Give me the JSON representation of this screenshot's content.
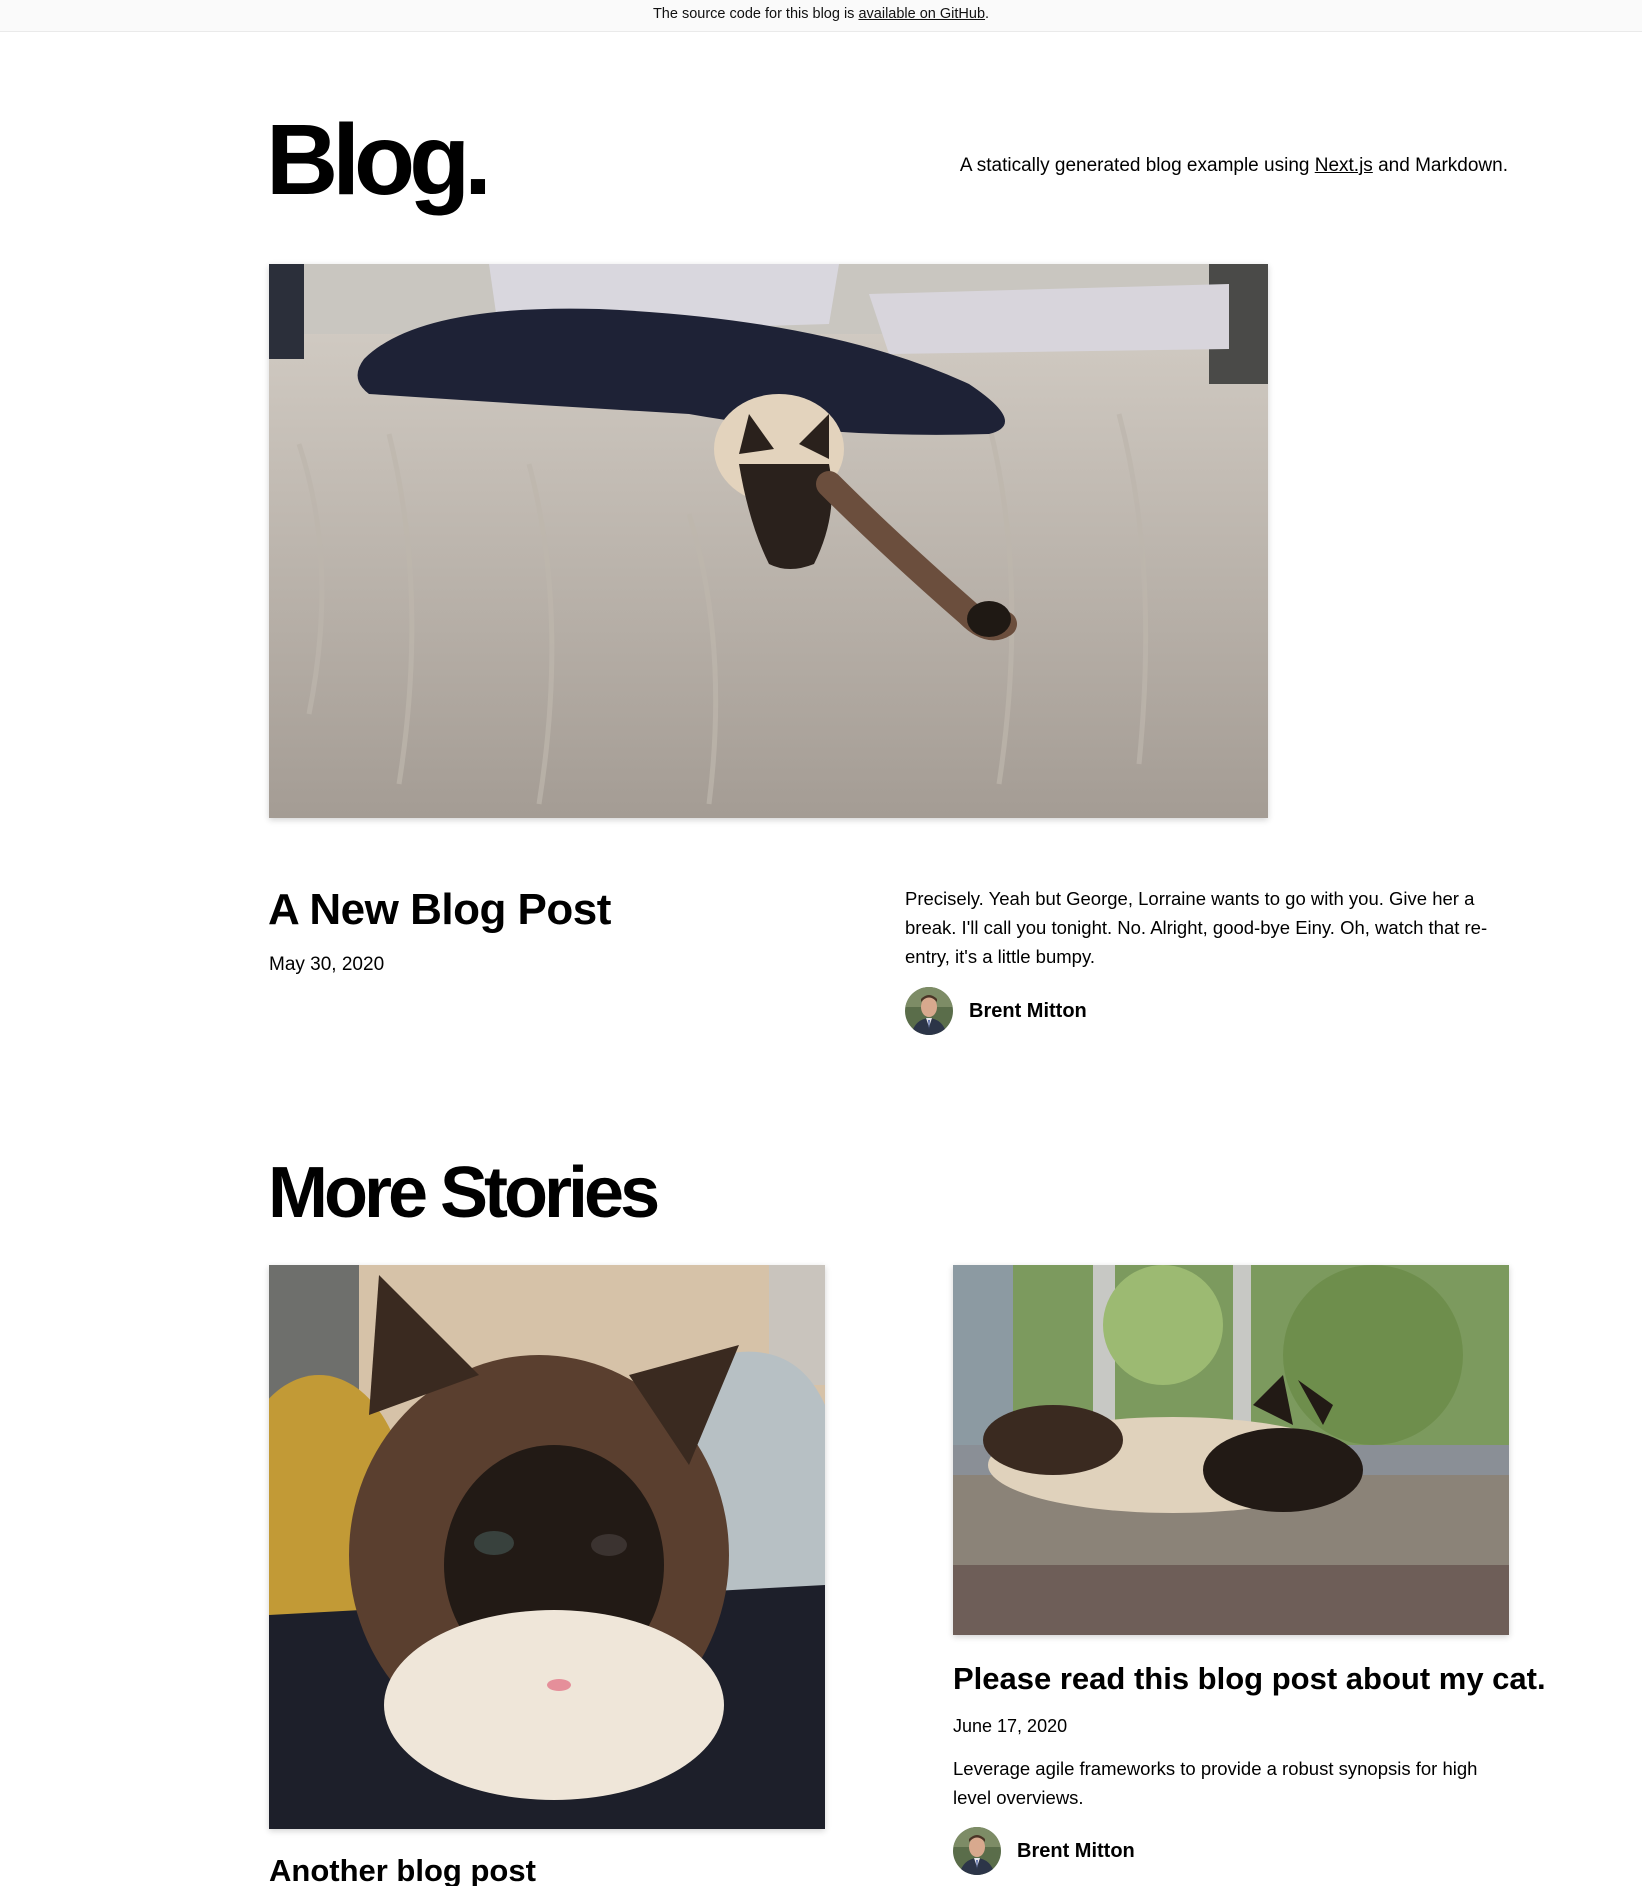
{
  "banner": {
    "prefix": "The source code for this blog is ",
    "link": "available on GitHub",
    "suffix": "."
  },
  "header": {
    "title": "Blog.",
    "description_prefix": "A statically generated blog example using ",
    "description_link": "Next.js",
    "description_suffix": " and Markdown."
  },
  "hero": {
    "title": "A New Blog Post",
    "date": "May 30, 2020",
    "excerpt": "Precisely. Yeah but George, Lorraine wants to go with you. Give her a break. I'll call you tonight. No. Alright, good-bye Einy. Oh, watch that re-entry, it's a little bumpy.",
    "author": "Brent Mitton"
  },
  "more": {
    "heading": "More Stories",
    "posts": [
      {
        "title": "Another blog post"
      },
      {
        "title": "Please read this blog post about my cat.",
        "date": "June 17, 2020",
        "excerpt": "Leverage agile frameworks to provide a robust synopsis for high level overviews.",
        "author": "Brent Mitton"
      }
    ]
  },
  "colors": {
    "banner_bg": "#fafafa",
    "text": "#000000",
    "link": "#000000"
  }
}
